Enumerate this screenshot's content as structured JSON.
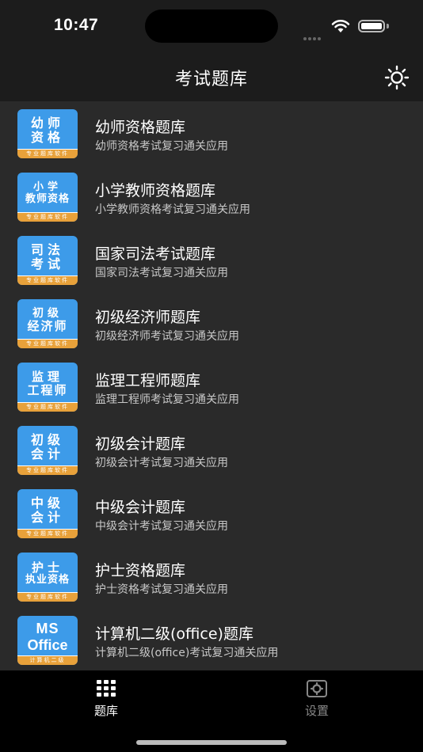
{
  "status": {
    "time": "10:47"
  },
  "nav": {
    "title": "考试题库"
  },
  "items": [
    {
      "title": "幼师资格题库",
      "subtitle": "幼师资格考试复习通关应用",
      "icon_line1": "幼师",
      "icon_line2": "资格",
      "icon_footer": "专业题库软件",
      "icon_name": "kindergarten-teacher-icon"
    },
    {
      "title": "小学教师资格题库",
      "subtitle": "小学教师资格考试复习通关应用",
      "icon_line1": "小学",
      "icon_line2": "教师资格",
      "icon_footer": "专业题库软件",
      "icon_name": "primary-teacher-icon"
    },
    {
      "title": "国家司法考试题库",
      "subtitle": "国家司法考试复习通关应用",
      "icon_line1": "司法",
      "icon_line2": "考试",
      "icon_footer": "专业题库软件",
      "icon_name": "judicial-exam-icon"
    },
    {
      "title": "初级经济师题库",
      "subtitle": "初级经济师考试复习通关应用",
      "icon_line1": "初级",
      "icon_line2": "经济师",
      "icon_footer": "专业题库软件",
      "icon_name": "junior-economist-icon"
    },
    {
      "title": "监理工程师题库",
      "subtitle": "监理工程师考试复习通关应用",
      "icon_line1": "监理",
      "icon_line2": "工程师",
      "icon_footer": "专业题库软件",
      "icon_name": "supervision-engineer-icon"
    },
    {
      "title": "初级会计题库",
      "subtitle": "初级会计考试复习通关应用",
      "icon_line1": "初级",
      "icon_line2": "会计",
      "icon_footer": "专业题库软件",
      "icon_name": "junior-accounting-icon"
    },
    {
      "title": "中级会计题库",
      "subtitle": "中级会计考试复习通关应用",
      "icon_line1": "中级",
      "icon_line2": "会计",
      "icon_footer": "专业题库软件",
      "icon_name": "intermediate-accounting-icon"
    },
    {
      "title": "护士资格题库",
      "subtitle": "护士资格考试复习通关应用",
      "icon_line1": "护士",
      "icon_line2": "执业资格",
      "icon_footer": "专业题库软件",
      "icon_name": "nurse-qualification-icon"
    },
    {
      "title": "计算机二级(office)题库",
      "subtitle": "计算机二级(office)考试复习通关应用",
      "icon_line1": "MS",
      "icon_line2": "Office",
      "icon_footer": "计算机二级",
      "icon_name": "ms-office-icon"
    }
  ],
  "tabs": [
    {
      "label": "题库",
      "icon": "grid-icon",
      "active": true
    },
    {
      "label": "设置",
      "icon": "settings-icon",
      "active": false
    }
  ],
  "colors": {
    "accent_icon_bg": "#3d9be9",
    "icon_stripe": "#e8a13a",
    "list_bg": "#2a2a2a",
    "nav_bg": "#1c1c1c"
  }
}
